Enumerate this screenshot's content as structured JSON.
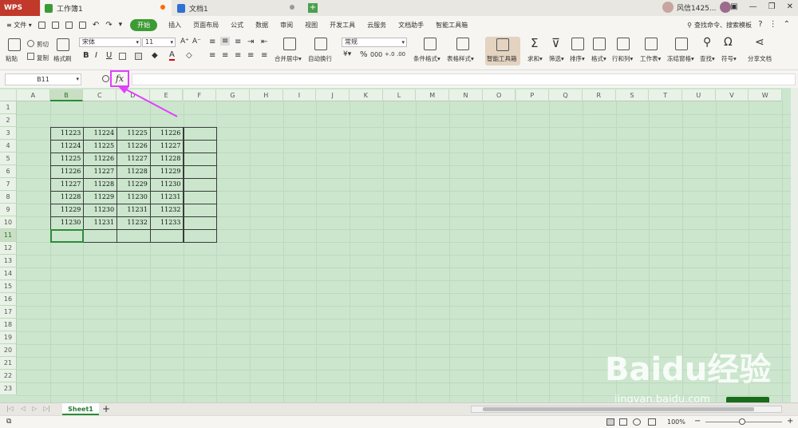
{
  "titlebar": {
    "app_name": "WPS",
    "tabs": [
      {
        "label": "工作簿1",
        "icon": "spreadsheet-doc-icon",
        "color": "#3d9b35"
      },
      {
        "label": "文档1",
        "icon": "word-doc-icon",
        "color": "#2f6fd6"
      }
    ],
    "user_name": "风信1425..."
  },
  "menubar": {
    "file": "文件",
    "tabs": [
      "开始",
      "插入",
      "页面布局",
      "公式",
      "数据",
      "审阅",
      "视图",
      "开发工具",
      "云服务",
      "文档助手",
      "智能工具箱"
    ],
    "search": "查找命令、搜索模板"
  },
  "ribbon": {
    "paste": "粘贴",
    "cut": "剪切",
    "copy": "复制",
    "format_painter": "格式刷",
    "font_name": "宋体",
    "font_size": "11",
    "merge": "合并居中",
    "wrap": "自动换行",
    "number_format": "常规",
    "cond_format": "条件格式",
    "table_style": "表格样式",
    "smart_toolbox": "智能工具箱",
    "sum": "求和",
    "filter": "筛选",
    "sort": "排序",
    "format": "格式",
    "rows_cols": "行和列",
    "worksheet": "工作表",
    "freeze": "冻结窗格",
    "find": "查找",
    "symbol": "符号",
    "share": "分享文档"
  },
  "formula": {
    "name_box": "B11",
    "fx": "fx",
    "value": ""
  },
  "grid": {
    "columns": [
      "A",
      "B",
      "C",
      "D",
      "E",
      "F",
      "G",
      "H",
      "I",
      "J",
      "K",
      "L",
      "M",
      "N",
      "O",
      "P",
      "Q",
      "R",
      "S",
      "T",
      "U",
      "V",
      "W"
    ],
    "rows": [
      "1",
      "2",
      "3",
      "4",
      "5",
      "6",
      "7",
      "8",
      "9",
      "10",
      "11",
      "12",
      "13",
      "14",
      "15",
      "16",
      "17",
      "18",
      "19",
      "20",
      "21",
      "22",
      "23"
    ],
    "selected_col": "B",
    "selected_row": "11",
    "data": [
      [
        "11223",
        "11224",
        "11225",
        "11226",
        ""
      ],
      [
        "11224",
        "11225",
        "11226",
        "11227",
        ""
      ],
      [
        "11225",
        "11226",
        "11227",
        "11228",
        ""
      ],
      [
        "11226",
        "11227",
        "11228",
        "11229",
        ""
      ],
      [
        "11227",
        "11228",
        "11229",
        "11230",
        ""
      ],
      [
        "11228",
        "11229",
        "11230",
        "11231",
        ""
      ],
      [
        "11229",
        "11230",
        "11231",
        "11232",
        ""
      ],
      [
        "11230",
        "11231",
        "11232",
        "11233",
        ""
      ],
      [
        "",
        "",
        "",
        "",
        ""
      ]
    ]
  },
  "sheettabs": {
    "active": "Sheet1",
    "add": "+"
  },
  "statusbar": {
    "zoom": "100%"
  },
  "watermark": {
    "logo": "Baidu经验",
    "site": "jingyan.baidu.com"
  },
  "colors": {
    "sheet_bg": "#cbe6cd",
    "accent": "#3d9b35",
    "annotation": "#e040fb"
  }
}
